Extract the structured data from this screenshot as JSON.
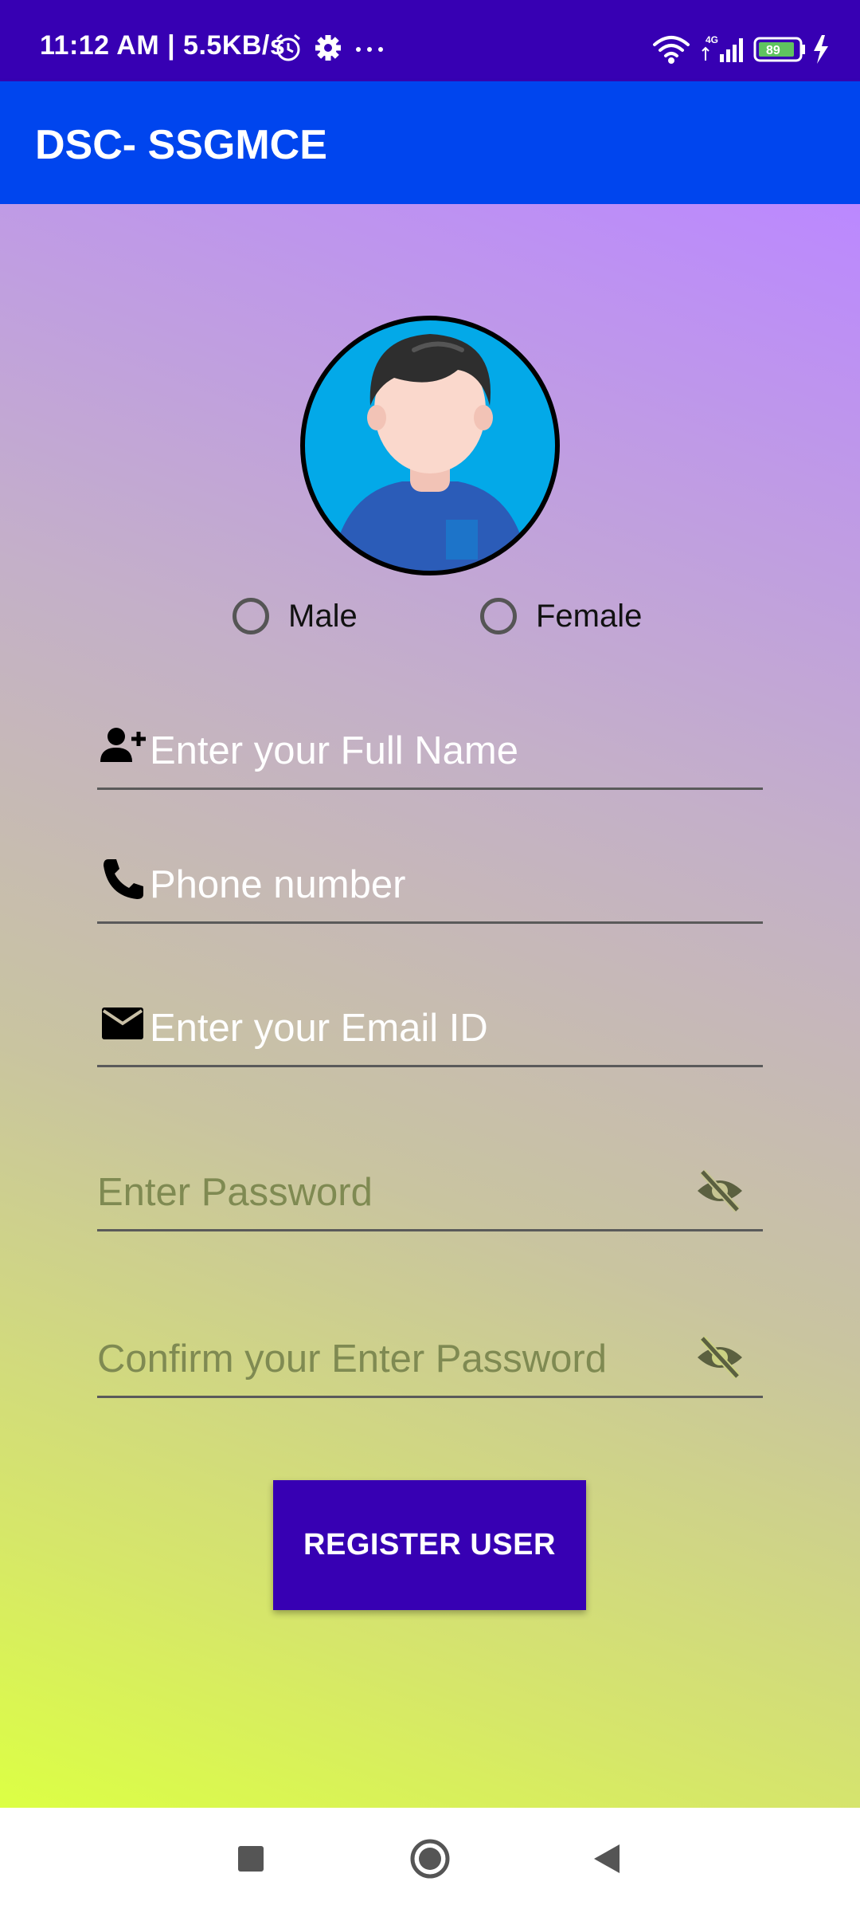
{
  "status_bar": {
    "time": "11:12 AM | 5.5KB/s",
    "icons": [
      "alarm-icon",
      "settings-icon",
      "more-dots-icon",
      "wifi-icon",
      "signal-4g-icon",
      "battery-icon",
      "charging-icon"
    ],
    "battery_level": "89",
    "network_label": "4G"
  },
  "app_bar": {
    "title": "DSC- SSGMCE"
  },
  "form": {
    "gender": {
      "male_label": "Male",
      "female_label": "Female",
      "selected": ""
    },
    "full_name": {
      "placeholder": "Enter your Full Name",
      "icon": "person-add-icon"
    },
    "phone": {
      "placeholder": "Phone number",
      "icon": "phone-icon"
    },
    "email": {
      "placeholder": "Enter your Email ID",
      "icon": "email-icon"
    },
    "password": {
      "placeholder": "Enter Password",
      "icon": "visibility-off-icon"
    },
    "confirm_password": {
      "placeholder": "Confirm your Enter Password",
      "icon": "visibility-off-icon"
    },
    "register_label": "REGISTER USER"
  },
  "nav_bar": {
    "buttons": [
      "recents-square-icon",
      "home-circle-icon",
      "back-triangle-icon"
    ]
  },
  "colors": {
    "status_bar": "#3700B3",
    "app_bar": "#0045EE",
    "button": "#3700B3",
    "gradient_top": "#bb88ff",
    "gradient_bottom": "#dcff44"
  }
}
